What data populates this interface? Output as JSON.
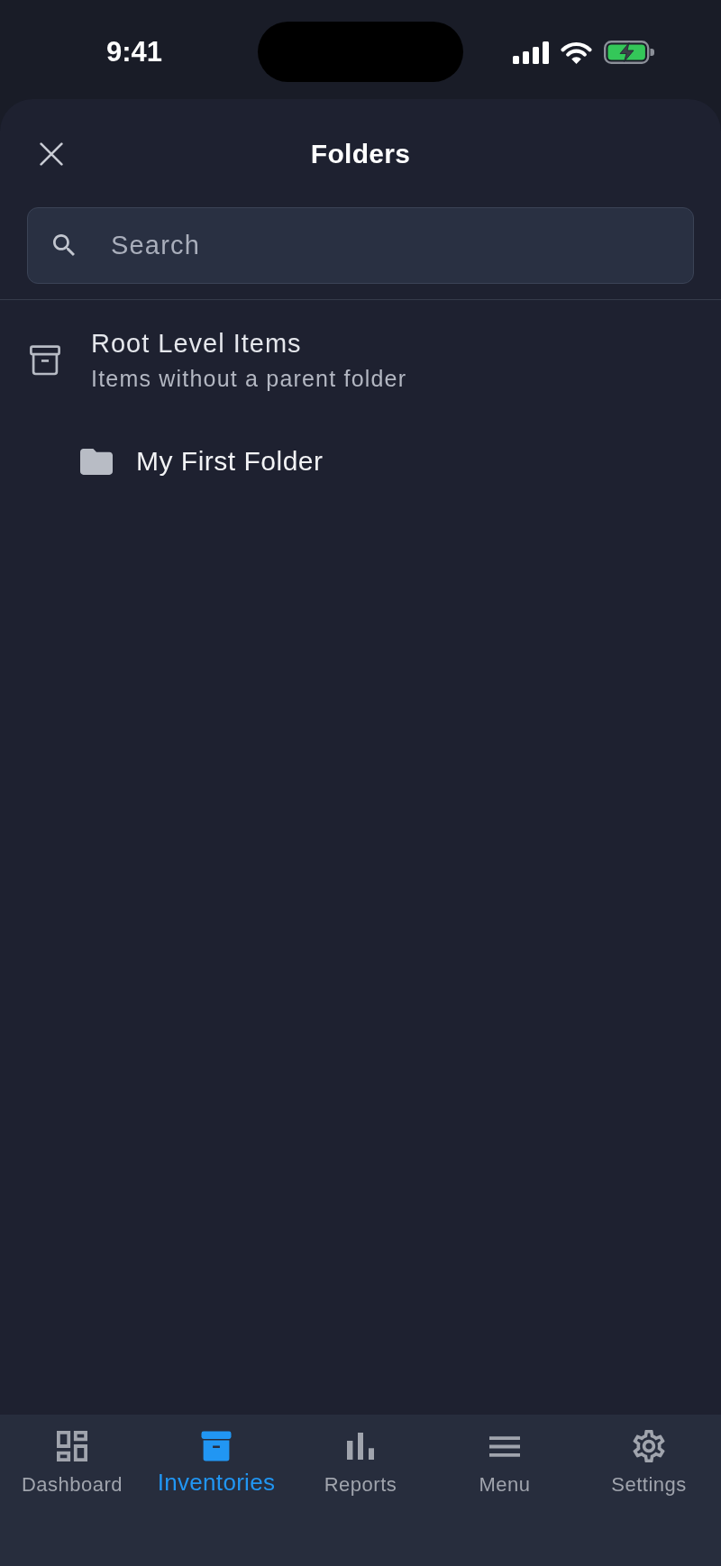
{
  "status_bar": {
    "time": "9:41"
  },
  "sheet": {
    "title": "Folders",
    "search": {
      "placeholder": "Search"
    },
    "folders": [
      {
        "kind": "root",
        "title": "Root Level Items",
        "subtitle": "Items without a parent folder",
        "children": [
          {
            "kind": "folder",
            "title": "My First Folder"
          }
        ]
      }
    ]
  },
  "tab_bar": {
    "tabs": [
      {
        "label": "Dashboard",
        "selected": false
      },
      {
        "label": "Inventories",
        "selected": true
      },
      {
        "label": "Reports",
        "selected": false
      },
      {
        "label": "Menu",
        "selected": false
      },
      {
        "label": "Settings",
        "selected": false
      }
    ]
  }
}
